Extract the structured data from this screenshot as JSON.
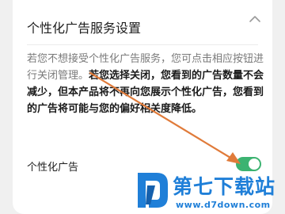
{
  "section": {
    "title": "个性化广告服务设置"
  },
  "description": {
    "normal": "若您不想接受个性化广告服务，您可点击相应按钮进行关闭管理。",
    "bold": "若您选择关闭，您看到的广告数量不会减少，但本产品将不再向您展示个性化广告，您看到的广告将可能与您的偏好相关度降低。"
  },
  "setting": {
    "label": "个性化广告",
    "enabled": true
  },
  "watermark": {
    "title": "第七下载站",
    "url": "www.d7down.com"
  },
  "colors": {
    "toggle_on": "#3cb371",
    "arrow": "#e07b3a",
    "watermark": "#1f7fd8"
  },
  "icons": {
    "collapse": "chevron-up-icon",
    "logo": "d7-logo"
  }
}
